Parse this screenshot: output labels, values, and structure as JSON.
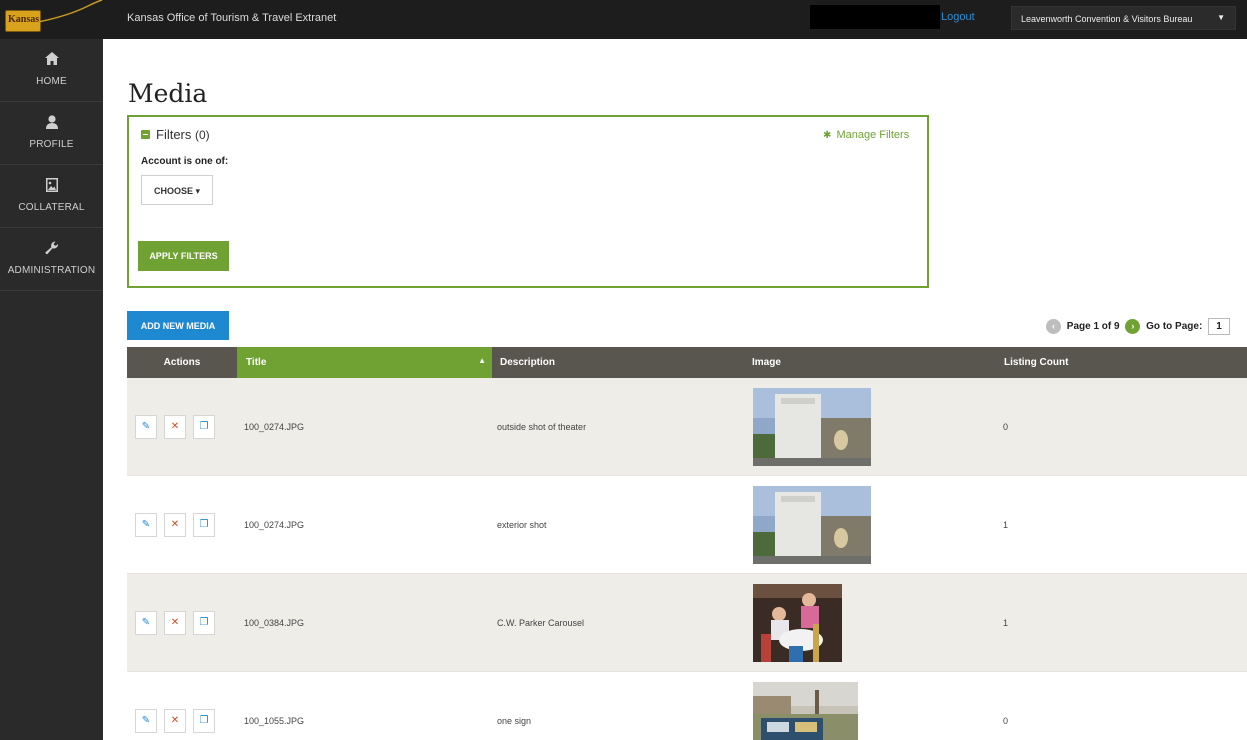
{
  "topbar": {
    "logo_text": "Kansas",
    "app_title": "Kansas Office of Tourism & Travel Extranet",
    "logout_label": "Logout",
    "org_select_value": "Leavenworth Convention & Visitors Bureau"
  },
  "sidebar": {
    "items": [
      {
        "label": "HOME",
        "icon": "home-icon"
      },
      {
        "label": "PROFILE",
        "icon": "user-icon"
      },
      {
        "label": "COLLATERAL",
        "icon": "image-file-icon"
      },
      {
        "label": "ADMINISTRATION",
        "icon": "wrench-icon"
      }
    ]
  },
  "page": {
    "title": "Media"
  },
  "filters": {
    "title": "Filters",
    "count": "(0)",
    "manage_label": "Manage Filters",
    "account_label": "Account is one of:",
    "choose_label": "CHOOSE",
    "apply_label": "APPLY FILTERS"
  },
  "toolbar": {
    "add_label": "ADD NEW MEDIA"
  },
  "pager": {
    "text": "Page 1 of 9",
    "goto_label": "Go to Page:",
    "current_page": "1"
  },
  "table": {
    "headers": {
      "actions": "Actions",
      "title": "Title",
      "description": "Description",
      "image": "Image",
      "listing_count": "Listing Count"
    },
    "rows": [
      {
        "title": "100_0274.JPG",
        "description": "outside shot of theater",
        "listing_count": "0"
      },
      {
        "title": "100_0274.JPG",
        "description": "exterior shot",
        "listing_count": "1"
      },
      {
        "title": "100_0384.JPG",
        "description": "C.W. Parker Carousel",
        "listing_count": "1"
      },
      {
        "title": "100_1055.JPG",
        "description": "one sign",
        "listing_count": "0"
      }
    ]
  },
  "colors": {
    "accent_green": "#6fa233",
    "accent_blue": "#1e88d1",
    "topbar_bg": "#1d1d1d",
    "sidebar_bg": "#2a2a2a",
    "table_header_bg": "#58564e"
  }
}
